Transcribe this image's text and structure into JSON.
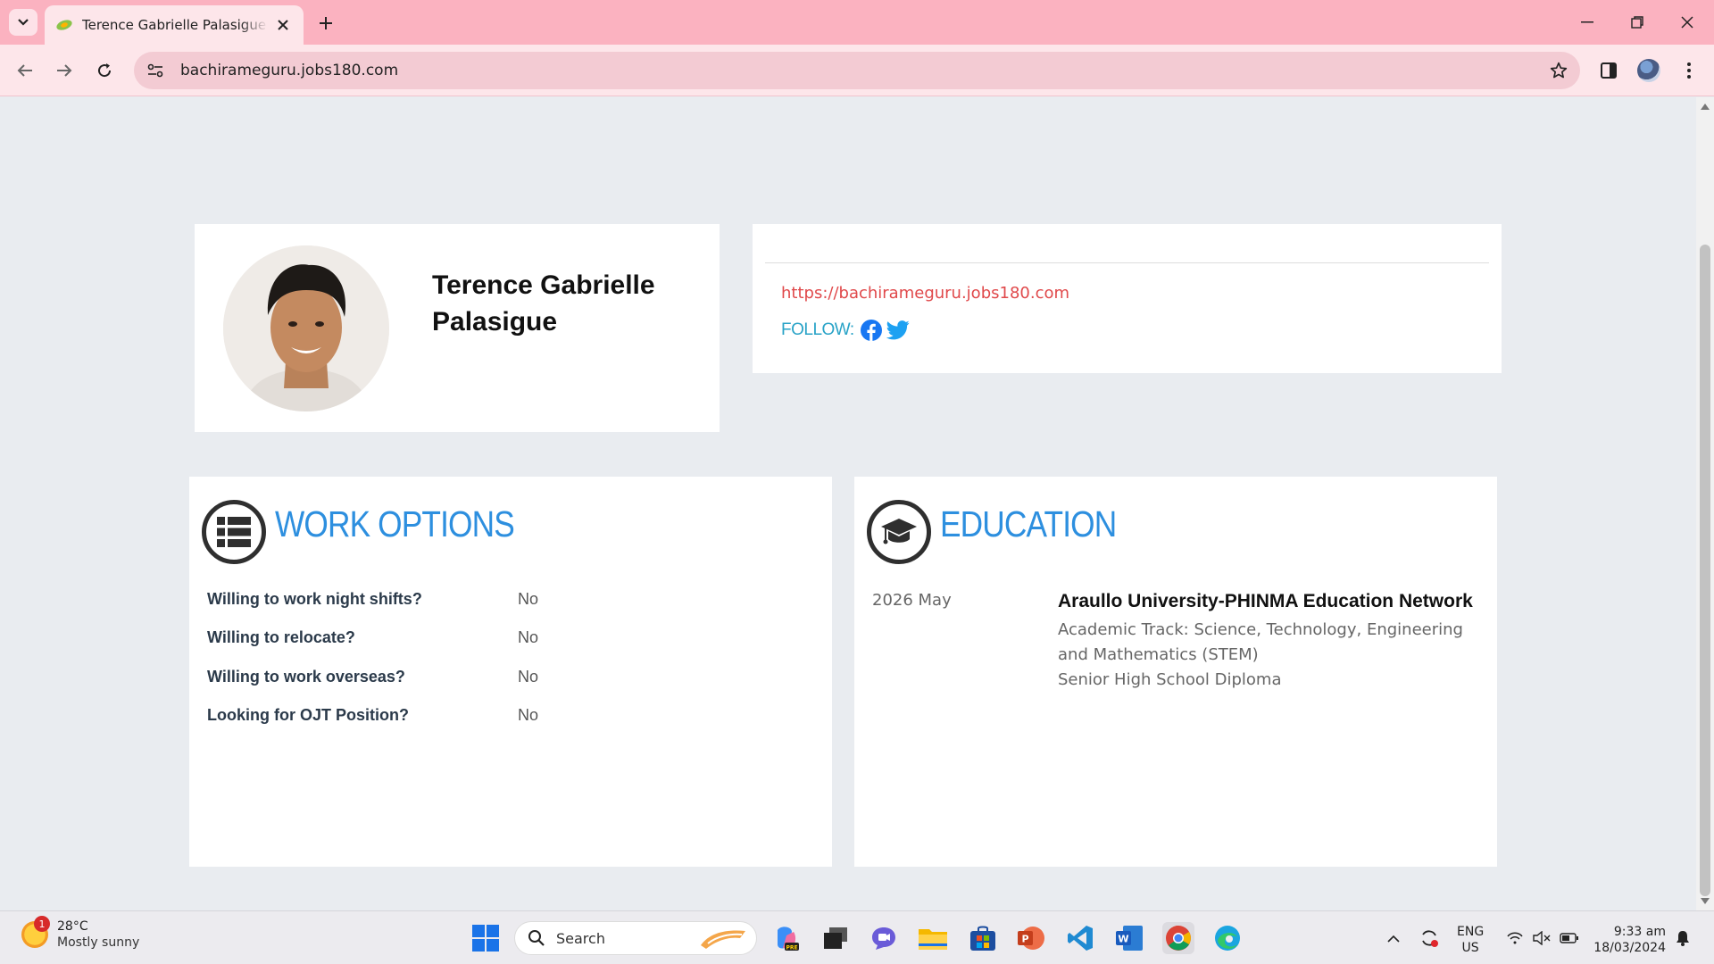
{
  "browser": {
    "tab_title": "Terence Gabrielle Palasigue - Jo",
    "url": "bachirameguru.jobs180.com"
  },
  "profile": {
    "name_line1": "Terence Gabrielle",
    "name_line2": "Palasigue"
  },
  "links": {
    "website": "https://bachirameguru.jobs180.com",
    "follow_label": "FOLLOW:"
  },
  "work_options": {
    "title": "WORK OPTIONS",
    "rows": [
      {
        "question": "Willing to work night shifts?",
        "answer": "No"
      },
      {
        "question": "Willing to relocate?",
        "answer": "No"
      },
      {
        "question": "Willing to work overseas?",
        "answer": "No"
      },
      {
        "question": "Looking for OJT Position?",
        "answer": "No"
      }
    ]
  },
  "education": {
    "title": "EDUCATION",
    "date": "2026 May",
    "school": "Araullo University-PHINMA Education Network",
    "track": "Academic Track: Science, Technology, Engineering and Mathematics (STEM)",
    "diploma": "Senior High School Diploma"
  },
  "taskbar": {
    "weather_badge": "1",
    "temperature": "28°C",
    "condition": "Mostly sunny",
    "search_label": "Search",
    "lang_line1": "ENG",
    "lang_line2": "US",
    "time": "9:33 am",
    "date": "18/03/2024"
  },
  "colors": {
    "tabbar": "#fbb2c0",
    "toolbar": "#fde6ea",
    "accent_blue": "#2d8fdf",
    "link_red": "#e0494b",
    "follow_teal": "#29a3c7",
    "page_bg": "#e9ecf0"
  },
  "icons": [
    "chevron-down-icon",
    "favicon-icon",
    "close-icon",
    "plus-icon",
    "minimize-icon",
    "restore-icon",
    "back-icon",
    "forward-icon",
    "reload-icon",
    "site-info-icon",
    "star-icon",
    "side-panel-icon",
    "menu-icon",
    "facebook-icon",
    "twitter-icon",
    "list-icon",
    "graduation-cap-icon",
    "windows-start-icon",
    "search-icon"
  ]
}
